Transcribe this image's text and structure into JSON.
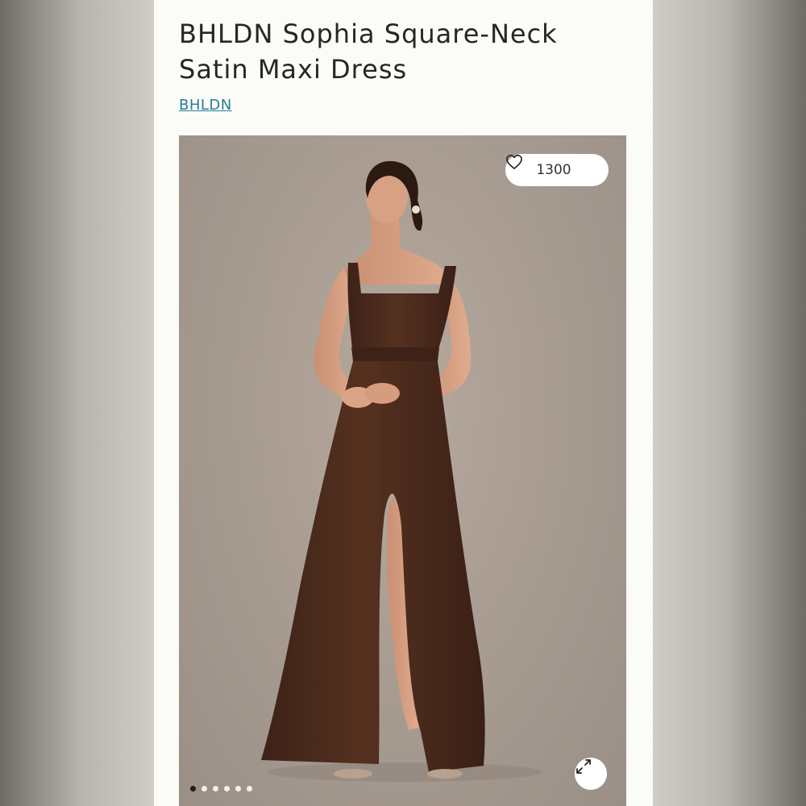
{
  "product": {
    "title_line1": "BHLDN Sophia Square-Neck",
    "title_line2": "Satin Maxi Dress",
    "brand": "BHLDN"
  },
  "gallery": {
    "likes": "1300",
    "heart_icon": "heart-outline-icon",
    "expand_icon": "expand-arrows-icon",
    "slide_count": 6,
    "active_slide": 1
  },
  "colors": {
    "brand_link": "#2a7c9a",
    "dress": "#4a2a1f",
    "card_background": "#fbfbf8"
  }
}
